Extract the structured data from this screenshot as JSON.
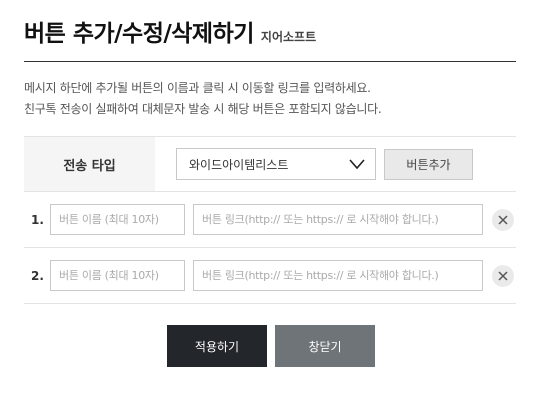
{
  "header": {
    "title": "버튼 추가/수정/삭제하기",
    "subtitle": "지어소프트"
  },
  "description": {
    "line1": "메시지 하단에 추가될 버튼의 이름과 클릭 시 이동할 링크를 입력하세요.",
    "line2": "친구톡 전송이 실패하여 대체문자 발송 시 해당 버튼은 포함되지 않습니다."
  },
  "send_type": {
    "label": "전송 타입",
    "selected": "와이드아이템리스트",
    "add_button_label": "버튼추가"
  },
  "button_rows": [
    {
      "number": "1.",
      "name_value": "",
      "name_placeholder": "버튼 이름 (최대 10자)",
      "link_value": "",
      "link_placeholder": "버튼 링크(http:// 또는 https:// 로 시작해야 합니다.)"
    },
    {
      "number": "2.",
      "name_value": "",
      "name_placeholder": "버튼 이름 (최대 10자)",
      "link_value": "",
      "link_placeholder": "버튼 링크(http:// 또는 https:// 로 시작해야 합니다.)"
    }
  ],
  "footer": {
    "apply_label": "적용하기",
    "close_label": "창닫기"
  },
  "icons": {
    "select_chevron": "chevron-down-icon",
    "delete": "close-icon"
  },
  "colors": {
    "apply_button": "#23272b",
    "close_button": "#6f7478",
    "label_cell_bg": "#f5f5f5"
  }
}
